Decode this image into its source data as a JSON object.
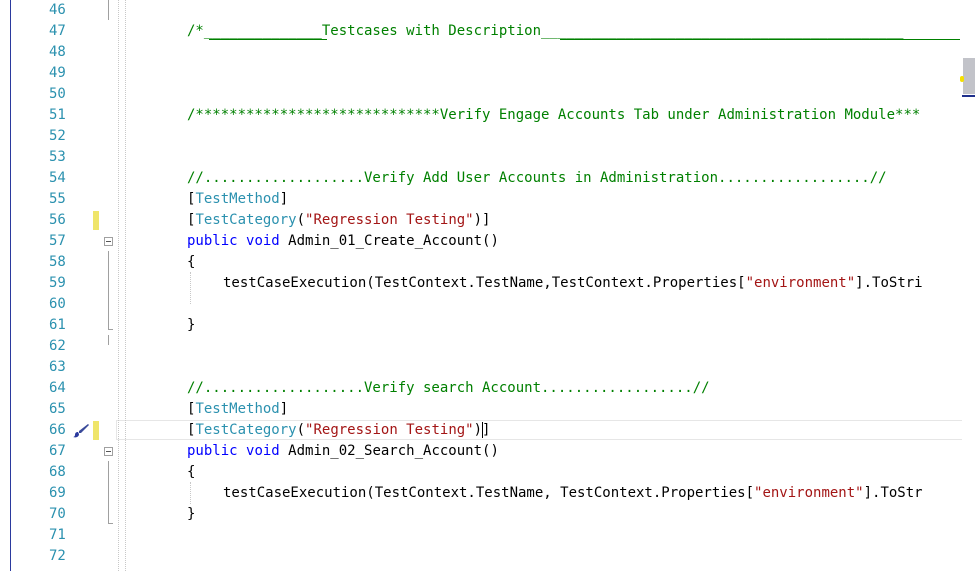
{
  "editor": {
    "lines": [
      {
        "num": "46",
        "parts": []
      },
      {
        "num": "47",
        "parts": [
          {
            "t": "/*______________Testcases with Description___________________________________________",
            "c": "comment"
          }
        ]
      },
      {
        "num": "48",
        "parts": []
      },
      {
        "num": "49",
        "parts": []
      },
      {
        "num": "50",
        "parts": []
      },
      {
        "num": "51",
        "parts": [
          {
            "t": "/*****************************Verify Engage Accounts Tab under Administration Module***",
            "c": "comment"
          }
        ]
      },
      {
        "num": "52",
        "parts": []
      },
      {
        "num": "53",
        "parts": []
      },
      {
        "num": "54",
        "parts": [
          {
            "t": "//...................Verify Add User Accounts in Administration..................//",
            "c": "comment"
          }
        ]
      },
      {
        "num": "55",
        "parts": [
          {
            "t": "[",
            "c": "plain"
          },
          {
            "t": "TestMethod",
            "c": "type"
          },
          {
            "t": "]",
            "c": "plain"
          }
        ]
      },
      {
        "num": "56",
        "parts": [
          {
            "t": "[",
            "c": "plain"
          },
          {
            "t": "TestCategory",
            "c": "type"
          },
          {
            "t": "(",
            "c": "plain"
          },
          {
            "t": "\"Regression Testing\"",
            "c": "str"
          },
          {
            "t": ")]",
            "c": "plain"
          }
        ]
      },
      {
        "num": "57",
        "parts": [
          {
            "t": "public",
            "c": "kw"
          },
          {
            "t": " ",
            "c": "plain"
          },
          {
            "t": "void",
            "c": "kw"
          },
          {
            "t": " Admin_01_Create_Account()",
            "c": "plain"
          }
        ]
      },
      {
        "num": "58",
        "parts": [
          {
            "t": "{",
            "c": "plain"
          }
        ]
      },
      {
        "num": "59",
        "parts": [
          {
            "t": "testCaseExecution(TestContext.TestName,TestContext.Properties[",
            "c": "plain"
          },
          {
            "t": "\"environment\"",
            "c": "str"
          },
          {
            "t": "].ToStri",
            "c": "plain"
          }
        ],
        "indent": true
      },
      {
        "num": "60",
        "parts": []
      },
      {
        "num": "61",
        "parts": [
          {
            "t": "}",
            "c": "plain"
          }
        ]
      },
      {
        "num": "62",
        "parts": []
      },
      {
        "num": "63",
        "parts": []
      },
      {
        "num": "64",
        "parts": [
          {
            "t": "//...................Verify search Account..................//",
            "c": "comment"
          }
        ]
      },
      {
        "num": "65",
        "parts": [
          {
            "t": "[",
            "c": "plain"
          },
          {
            "t": "TestMethod",
            "c": "type"
          },
          {
            "t": "]",
            "c": "plain"
          }
        ]
      },
      {
        "num": "66",
        "parts": [
          {
            "t": "[",
            "c": "plain"
          },
          {
            "t": "TestCategory",
            "c": "type"
          },
          {
            "t": "(",
            "c": "plain"
          },
          {
            "t": "\"Regression Testing\"",
            "c": "str"
          },
          {
            "t": ")]",
            "c": "plain"
          }
        ]
      },
      {
        "num": "67",
        "parts": [
          {
            "t": "public",
            "c": "kw"
          },
          {
            "t": " ",
            "c": "plain"
          },
          {
            "t": "void",
            "c": "kw"
          },
          {
            "t": " Admin_02_Search_Account()",
            "c": "plain"
          }
        ]
      },
      {
        "num": "68",
        "parts": [
          {
            "t": "{",
            "c": "plain"
          }
        ]
      },
      {
        "num": "69",
        "parts": [
          {
            "t": "testCaseExecution(TestContext.TestName, TestContext.Properties[",
            "c": "plain"
          },
          {
            "t": "\"environment\"",
            "c": "str"
          },
          {
            "t": "].ToStr",
            "c": "plain"
          }
        ],
        "indent": true
      },
      {
        "num": "70",
        "parts": [
          {
            "t": "}",
            "c": "plain"
          }
        ]
      },
      {
        "num": "71",
        "parts": []
      },
      {
        "num": "72",
        "parts": []
      }
    ],
    "changed_lines": [
      "56",
      "66"
    ],
    "current_line": "66",
    "icons": {
      "quick_action": "paintbrush-icon",
      "collapse": "collapse-icon"
    },
    "colors": {
      "line_number": "#2b91af",
      "comment": "#008000",
      "keyword": "#0000ff",
      "type": "#2b91af",
      "string": "#a31515",
      "change_marker": "#efe56a"
    }
  }
}
